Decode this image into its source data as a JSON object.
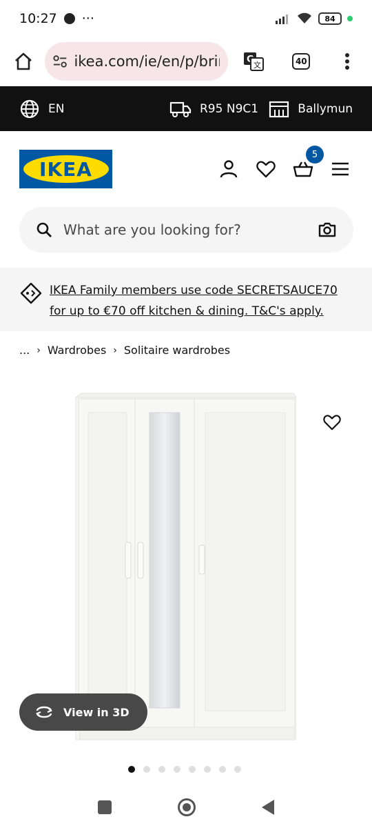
{
  "status_bar": {
    "time": "10:27",
    "dots": "···",
    "battery": "84"
  },
  "browser": {
    "url": "ikea.com/ie/en/p/brim",
    "tab_count": "40"
  },
  "top_strip": {
    "language": "EN",
    "postcode": "R95 N9C1",
    "store": "Ballymun"
  },
  "header": {
    "logo": "IKEA",
    "cart_count": "5"
  },
  "search": {
    "placeholder": "What are you looking for?"
  },
  "promo": {
    "text": "IKEA Family members use code SECRETSAUCE70 for up to €70 off kitchen & dining. T&C's apply."
  },
  "breadcrumb": {
    "ellipsis": "...",
    "items": [
      "Wardrobes",
      "Solitaire wardrobes"
    ]
  },
  "product": {
    "view_3d_label": "View in 3D",
    "image_count": 8,
    "active_image": 0
  },
  "colors": {
    "ikea_blue": "#0058a3",
    "ikea_yellow": "#ffdb00",
    "top_strip": "#111111",
    "url_pill": "#f6e6ea"
  }
}
